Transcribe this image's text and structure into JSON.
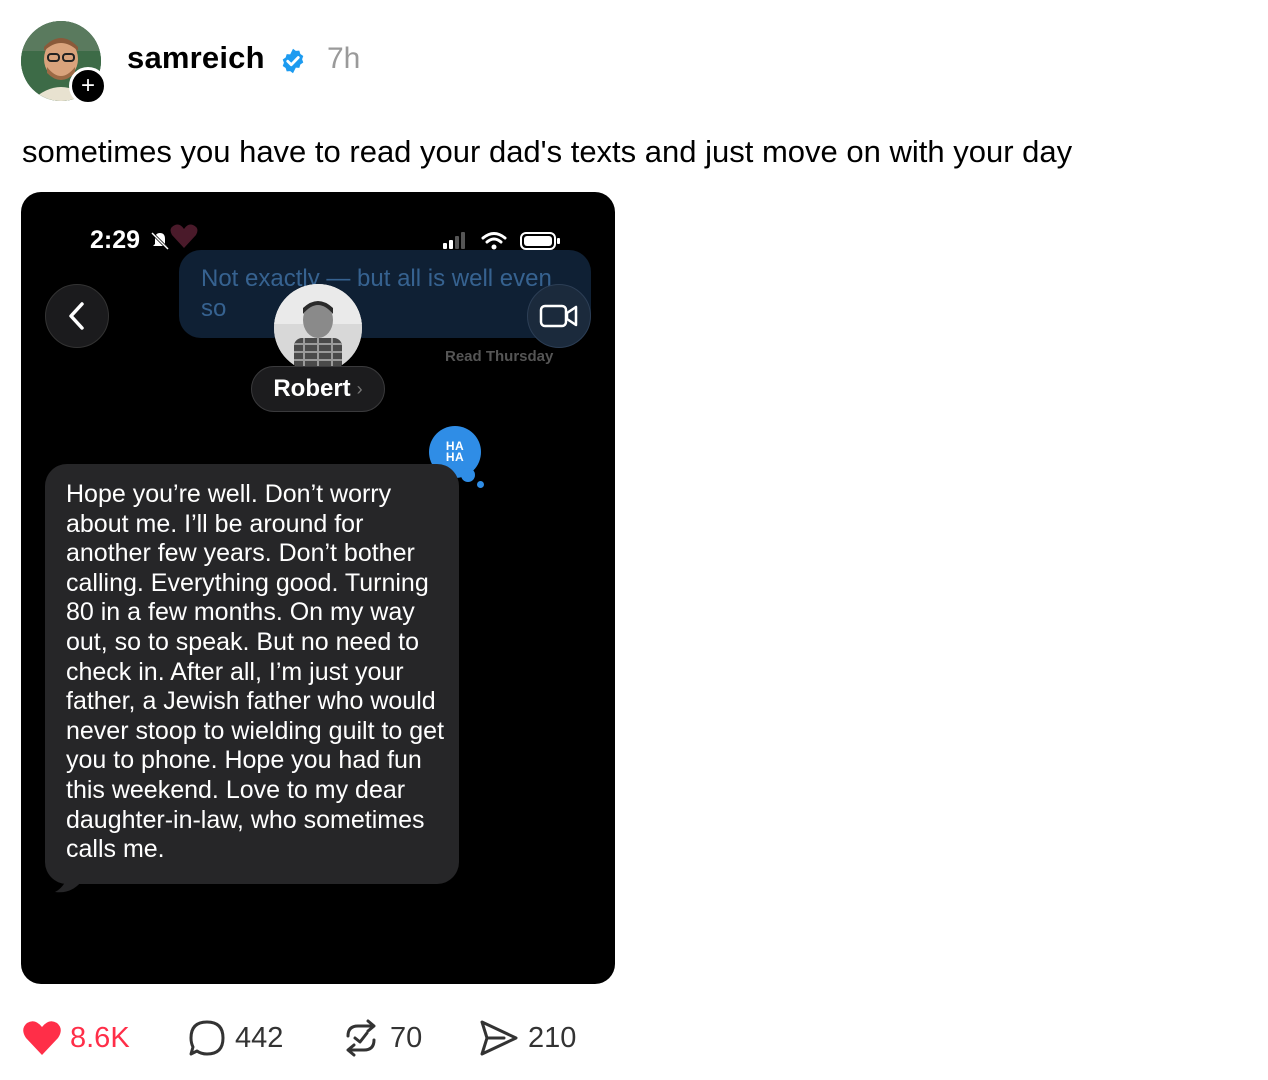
{
  "post": {
    "username": "samreich",
    "time": "7h",
    "caption": "sometimes you have to read your dad's texts and just move on with your day"
  },
  "screenshot": {
    "status_time": "2:29",
    "ghost_message": "Not exactly — but all is well even so",
    "read_receipt": "Read Thursday",
    "contact_name": "Robert",
    "tapback": "HA HA",
    "message": "Hope you’re well. Don’t worry about me. I’ll be around for another few years. Don’t bother calling. Everything good. Turning 80 in a few months. On my way out, so to speak. But no need to check in. After all, I’m just your father, a Jewish father who would never stoop to wielding guilt to get you to phone. Hope you had fun this weekend. Love to my dear daughter-in-law, who sometimes calls me."
  },
  "actions": {
    "likes": "8.6K",
    "comments": "442",
    "reposts": "70",
    "shares": "210"
  },
  "colors": {
    "like": "#ff2e48",
    "verified": "#1d9bf0",
    "imessage_blue": "#2f8de6"
  },
  "icons": [
    "heart-icon",
    "comment-icon",
    "repost-icon",
    "share-icon",
    "verified-icon",
    "plus-icon",
    "back-icon",
    "video-icon"
  ]
}
